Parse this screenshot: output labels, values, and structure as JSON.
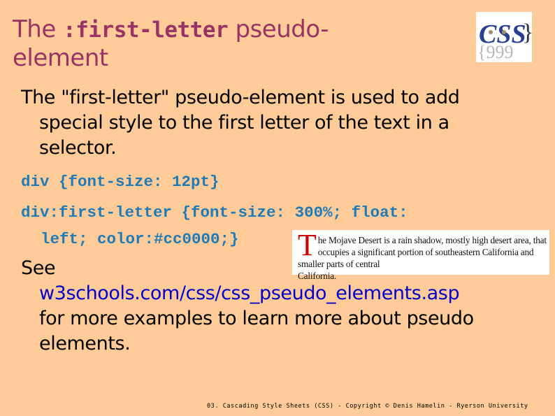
{
  "slide": {
    "title": {
      "prefix": "The ",
      "code": ":first-letter",
      "suffix": " pseudo-",
      "line2": "element"
    },
    "logo": {
      "icon": "css-logo-icon",
      "text": "CSS"
    },
    "intro": {
      "line1": "The \"first-letter\" pseudo-element is used to add",
      "line2": "special style to the first letter of the text in a",
      "line3": "selector."
    },
    "code": {
      "rule1": "div {font-size: 12pt}",
      "rule2_line1": "div:first-letter {font-size: 300%; float:",
      "rule2_line2": "left; color:#cc0000;}"
    },
    "example": {
      "first_letter": "T",
      "rest_line1": "he Mojave Desert is a rain shadow, mostly high desert area, that occupies a",
      "rest_line2": "significant portion of southeastern California and smaller parts of central",
      "rest_line3": "California.",
      "first_letter_color": "#cc0000"
    },
    "see": {
      "label": "See",
      "link": "w3schools.com/css/css_pseudo_elements.asp",
      "line3": "for more examples to learn more about pseudo",
      "line4": "elements."
    },
    "footer": "03. Cascading Style Sheets (CSS) - Copyright © Denis Hamelin - Ryerson University"
  },
  "colors": {
    "background": "#ffcc99",
    "title": "#993366",
    "code": "#1f7ab8",
    "link": "#0000cc"
  }
}
